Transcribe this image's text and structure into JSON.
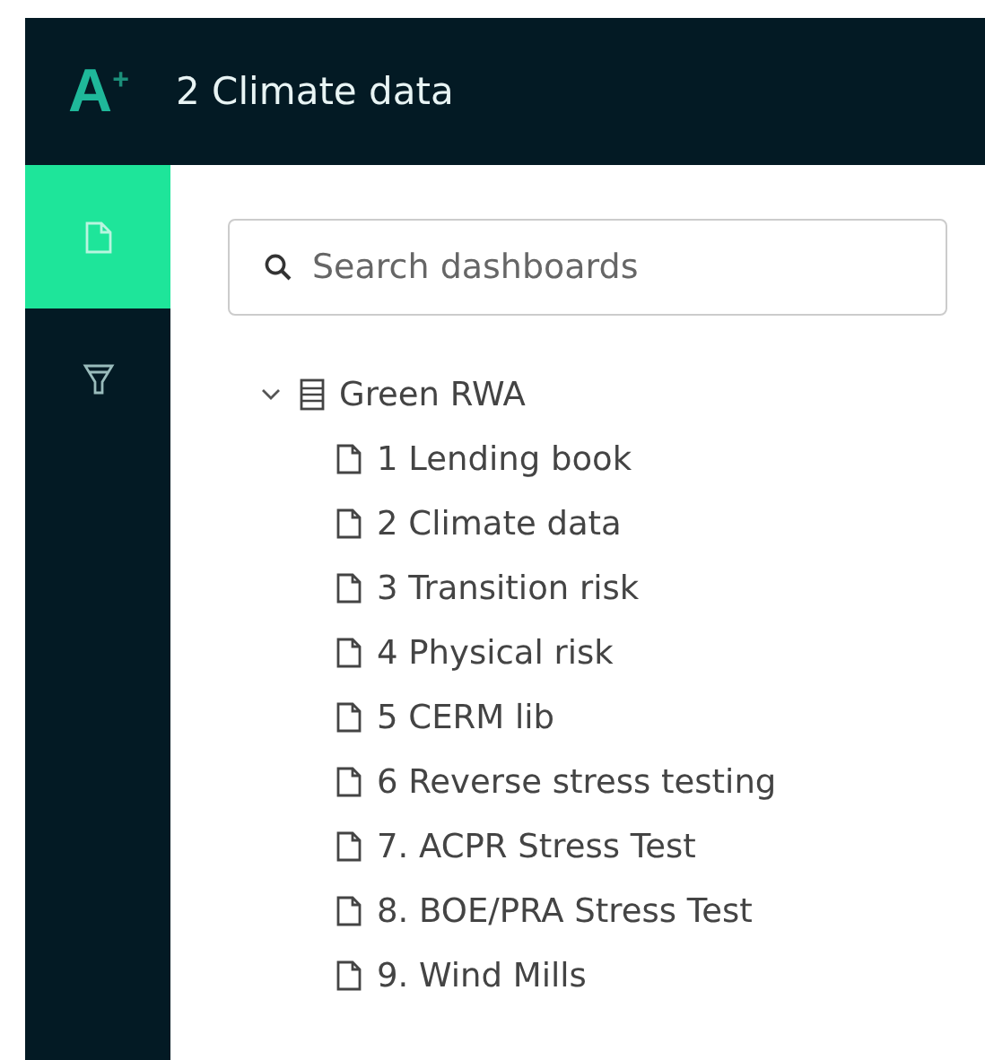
{
  "header": {
    "logo": "A$^{+}$",
    "title": "2 Climate data"
  },
  "nav": [
    {
      "kind": "document",
      "selected": true
    },
    {
      "kind": "filter",
      "selected": false
    }
  ],
  "search": {
    "placeholder": "Search dashboards"
  },
  "tree": [
    {
      "label": "Green RWA",
      "kind": "folder",
      "expanded": true,
      "children": [
        {
          "label": "1 Lending book",
          "kind": "dashboard"
        },
        {
          "label": "2 Climate data",
          "kind": "dashboard"
        },
        {
          "label": "3 Transition risk",
          "kind": "dashboard"
        },
        {
          "label": "4 Physical risk",
          "kind": "dashboard"
        },
        {
          "label": "5 CERM lib",
          "kind": "dashboard"
        },
        {
          "label": "6 Reverse stress testing",
          "kind": "dashboard"
        },
        {
          "label": "7. ACPR Stress Test",
          "kind": "dashboard"
        },
        {
          "label": "8. BOE/PRA Stress Test",
          "kind": "dashboard"
        },
        {
          "label": "9. Wind Mills",
          "kind": "dashboard"
        }
      ]
    }
  ]
}
